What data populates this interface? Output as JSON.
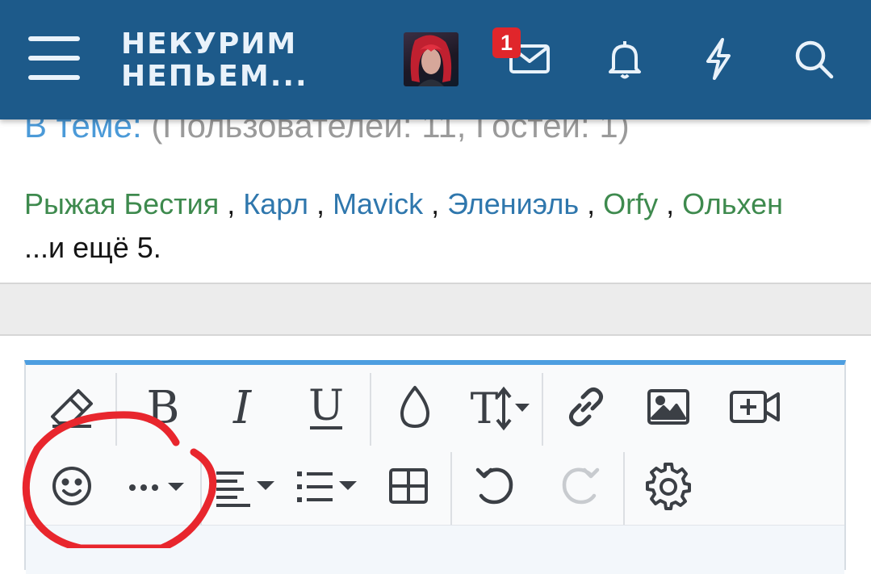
{
  "header": {
    "logo_line1": "НЕКУРИМ",
    "logo_line2": "НЕПЬЕМ...",
    "notification_count": "1",
    "icons": [
      "menu-icon",
      "avatar",
      "envelope-icon",
      "bell-icon",
      "lightning-icon",
      "search-icon"
    ],
    "background_color": "#1d5a8a"
  },
  "topic_viewers": {
    "label": "В теме:",
    "counts": "(Пользователей: 11, Гостей: 1)",
    "members": [
      {
        "name": "Рыжая Бестия",
        "color": "green"
      },
      {
        "name": "Карл",
        "color": "blue"
      },
      {
        "name": "Mavick",
        "color": "blue"
      },
      {
        "name": "Элениэль",
        "color": "blue"
      },
      {
        "name": "Orfy",
        "color": "green"
      },
      {
        "name": "Ольхен",
        "color": "green"
      }
    ],
    "more": "...и ещё 5."
  },
  "editor": {
    "toolbar_row1": [
      "eraser-icon",
      "bold-icon",
      "italic-icon",
      "underline-icon",
      "color-drop-icon",
      "font-size-icon",
      "link-icon",
      "image-icon",
      "video-icon"
    ],
    "toolbar_row2": [
      "smiley-icon",
      "more-options-icon",
      "align-icon",
      "list-icon",
      "table-icon",
      "undo-icon",
      "redo-icon",
      "settings-icon"
    ],
    "accent_color": "#4d9ee0"
  },
  "annotation": {
    "shape": "hand-drawn-circle",
    "color": "#e8262d",
    "target": "smiley-icon"
  }
}
